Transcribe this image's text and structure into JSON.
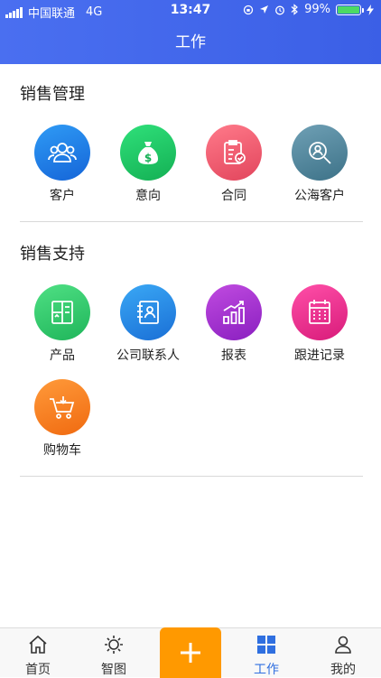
{
  "status_bar": {
    "carrier": "中国联通",
    "network": "4G",
    "time": "13:47",
    "battery_text": "99%",
    "battery_level": 0.99
  },
  "header": {
    "title": "工作"
  },
  "sections": [
    {
      "title": "销售管理",
      "items": [
        {
          "label": "客户",
          "icon": "customers-icon",
          "color_from": "#2f9bf5",
          "color_to": "#1565d8"
        },
        {
          "label": "意向",
          "icon": "money-bag-icon",
          "color_from": "#2fe07a",
          "color_to": "#14b054"
        },
        {
          "label": "合同",
          "icon": "contract-clipboard-icon",
          "color_from": "#ff7a8a",
          "color_to": "#e2455c"
        },
        {
          "label": "公海客户",
          "icon": "search-person-icon",
          "color_from": "#6fa0b5",
          "color_to": "#3d7288"
        }
      ]
    },
    {
      "title": "销售支持",
      "items": [
        {
          "label": "产品",
          "icon": "product-cabinet-icon",
          "color_from": "#4fe084",
          "color_to": "#1fb55a"
        },
        {
          "label": "公司联系人",
          "icon": "contact-book-icon",
          "color_from": "#3aa8f5",
          "color_to": "#1a6fd6"
        },
        {
          "label": "报表",
          "icon": "report-chart-icon",
          "color_from": "#c04be0",
          "color_to": "#8a1fc0"
        },
        {
          "label": "跟进记录",
          "icon": "calendar-record-icon",
          "color_from": "#ff4fa8",
          "color_to": "#d81b7a"
        },
        {
          "label": "购物车",
          "icon": "shopping-cart-icon",
          "color_from": "#ff9a3a",
          "color_to": "#f06a10"
        }
      ]
    }
  ],
  "tabbar": {
    "tabs": [
      {
        "label": "首页",
        "icon": "home-icon"
      },
      {
        "label": "智图",
        "icon": "sun-icon"
      },
      {
        "label": "工作",
        "icon": "grid-icon",
        "active": true
      },
      {
        "label": "我的",
        "icon": "person-icon"
      }
    ],
    "center_button_icon": "plus-icon",
    "accent_color": "#2f6fe0",
    "center_color": "#ff9900"
  }
}
